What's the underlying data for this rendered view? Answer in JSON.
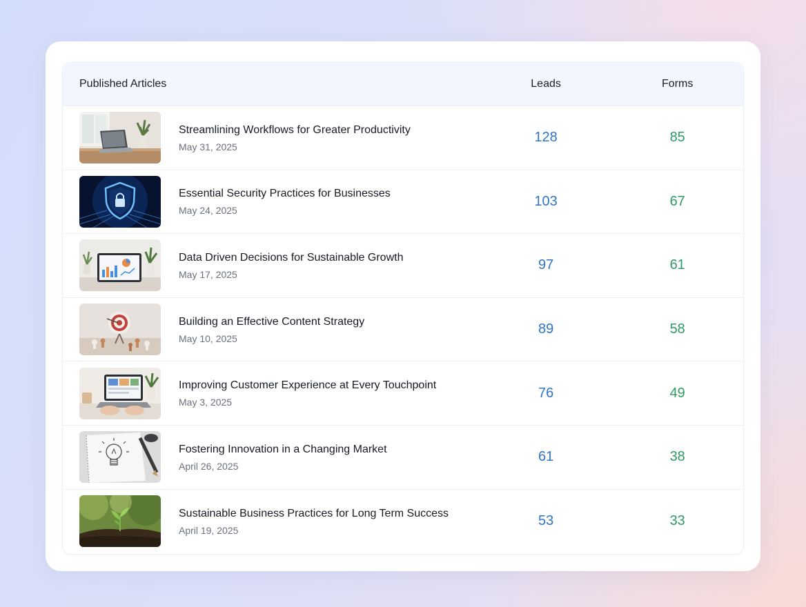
{
  "table": {
    "headers": {
      "article": "Published Articles",
      "leads": "Leads",
      "forms": "Forms"
    },
    "rows": [
      {
        "title": "Streamlining Workflows for Greater Productivity",
        "date": "May 31, 2025",
        "leads": "128",
        "forms": "85",
        "thumbnail": "laptop-desk-image"
      },
      {
        "title": "Essential Security Practices for Businesses",
        "date": "May 24, 2025",
        "leads": "103",
        "forms": "67",
        "thumbnail": "security-shield-image"
      },
      {
        "title": "Data Driven Decisions for Sustainable Growth",
        "date": "May 17, 2025",
        "leads": "97",
        "forms": "61",
        "thumbnail": "tablet-charts-image"
      },
      {
        "title": "Building an Effective Content Strategy",
        "date": "May 10, 2025",
        "leads": "89",
        "forms": "58",
        "thumbnail": "target-chess-image"
      },
      {
        "title": "Improving Customer Experience at Every Touchpoint",
        "date": "May 3, 2025",
        "leads": "76",
        "forms": "49",
        "thumbnail": "laptop-typing-image"
      },
      {
        "title": "Fostering Innovation in a Changing Market",
        "date": "April 26, 2025",
        "leads": "61",
        "forms": "38",
        "thumbnail": "lightbulb-sketch-image"
      },
      {
        "title": "Sustainable Business Practices for Long Term Success",
        "date": "April 19, 2025",
        "leads": "53",
        "forms": "33",
        "thumbnail": "seedling-soil-image"
      }
    ]
  },
  "colors": {
    "leads": "#2f74c6",
    "forms": "#2f9a63"
  }
}
